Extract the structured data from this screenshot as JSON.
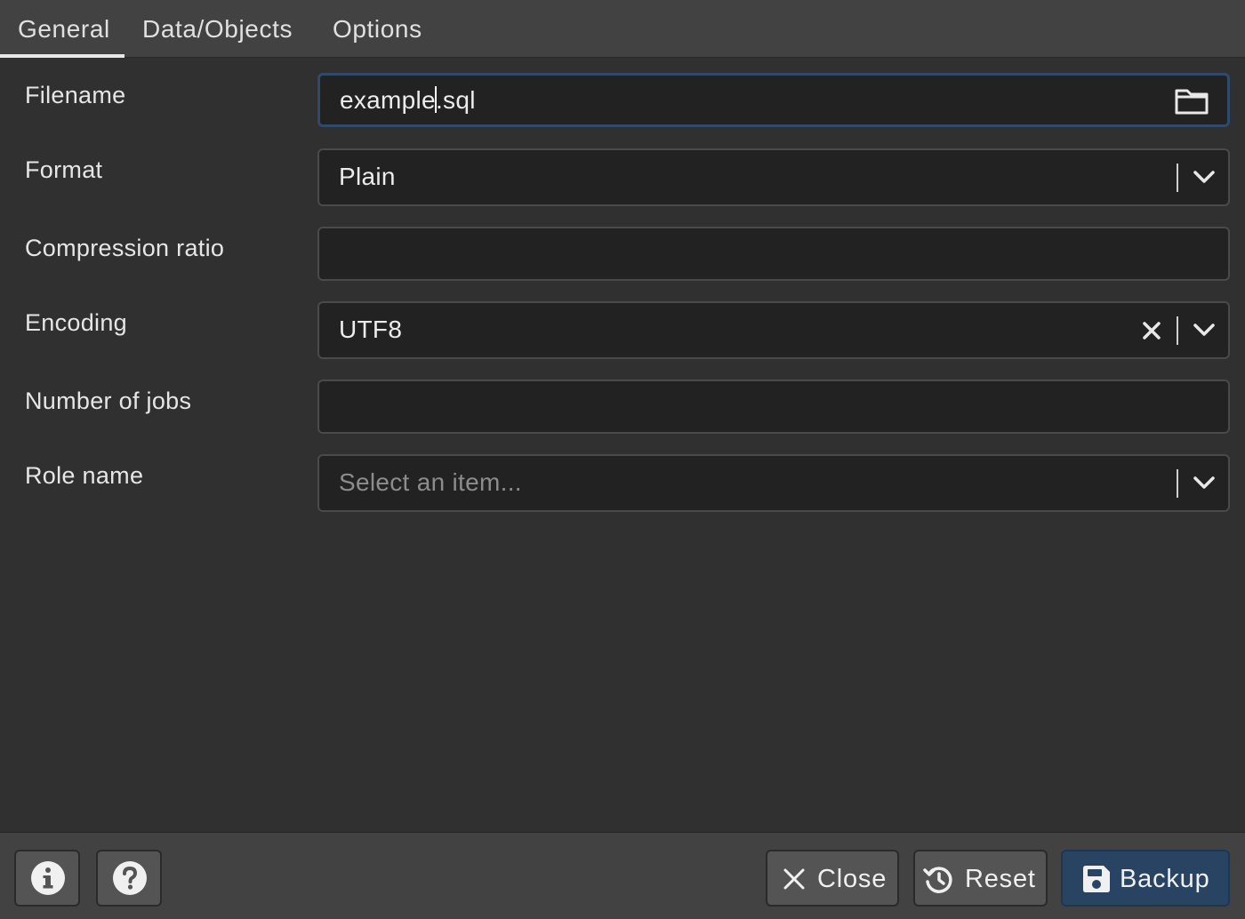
{
  "tabs": {
    "general": "General",
    "data_objects": "Data/Objects",
    "options": "Options",
    "active": "General"
  },
  "form": {
    "filename": {
      "label": "Filename",
      "value_before_caret": "example",
      "value_after_caret": ".sql",
      "icon": "folder-icon"
    },
    "format": {
      "label": "Format",
      "value": "Plain",
      "icon": "chevron-down-icon"
    },
    "compression_ratio": {
      "label": "Compression ratio",
      "value": ""
    },
    "encoding": {
      "label": "Encoding",
      "value": "UTF8",
      "icons": [
        "clear-icon",
        "chevron-down-icon"
      ]
    },
    "number_of_jobs": {
      "label": "Number of jobs",
      "value": ""
    },
    "role_name": {
      "label": "Role name",
      "placeholder": "Select an item...",
      "icon": "chevron-down-icon"
    }
  },
  "footer": {
    "info_icon": "info-icon",
    "help_icon": "help-icon",
    "close_label": "Close",
    "reset_label": "Reset",
    "backup_label": "Backup"
  },
  "colors": {
    "background": "#303030",
    "tabbar": "#424242",
    "input_bg": "#222222",
    "input_border": "#4a4a4a",
    "focus_border": "#2f4a6b",
    "primary_button": "#284462",
    "secondary_button": "#545454"
  }
}
